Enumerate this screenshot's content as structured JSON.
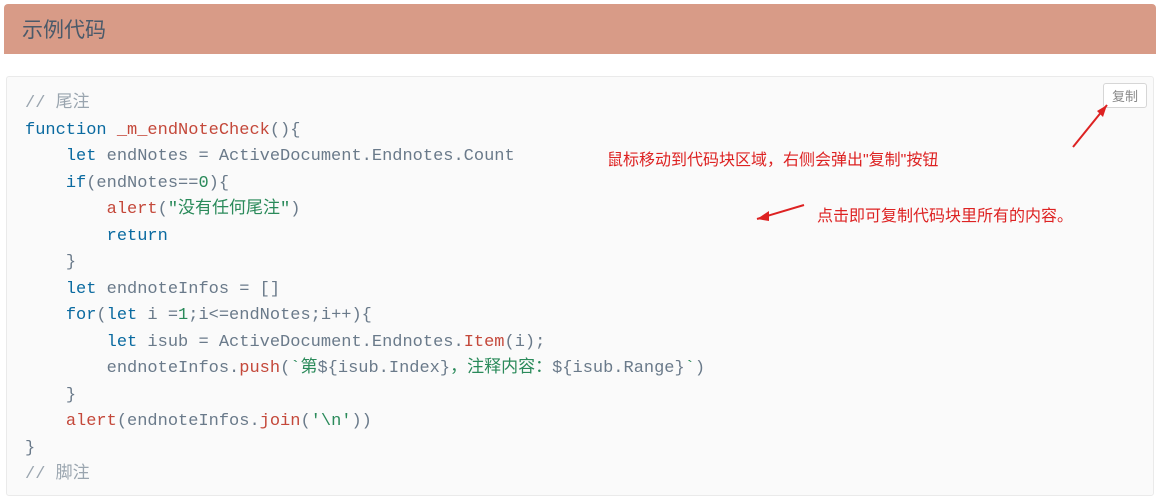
{
  "header": {
    "title": "示例代码"
  },
  "copy_button": {
    "label": "复制"
  },
  "annotations": {
    "line1": "鼠标移动到代码块区域，右侧会弹出\"复制\"按钮",
    "line2": "点击即可复制代码块里所有的内容。"
  },
  "code": {
    "raw": "// 尾注\nfunction _m_endNoteCheck(){\n    let endNotes = ActiveDocument.Endnotes.Count\n    if(endNotes==0){\n        alert(\"没有任何尾注\")\n        return\n    }\n    let endnoteInfos = []\n    for(let i =1;i<=endNotes;i++){\n        let isub = ActiveDocument.Endnotes.Item(i);\n        endnoteInfos.push(`第${isub.Index}，注释内容：${isub.Range}`)\n    }\n    alert(endnoteInfos.join('\\n'))\n}\n// 脚注",
    "l1_comment": "// 尾注",
    "l2_kw": "function",
    "l2_fn": "_m_endNoteCheck",
    "l2_rest": "(){",
    "l3_kw": "let",
    "l3_a": " endNotes = ActiveDocument.Endnotes.Count",
    "l4_kw": "if",
    "l4_a": "(endNotes==",
    "l4_num": "0",
    "l4_b": "){",
    "l5_fn": "alert",
    "l5_a": "(",
    "l5_str": "\"没有任何尾注\"",
    "l5_b": ")",
    "l6_kw": "return",
    "l7": "}",
    "l8_kw": "let",
    "l8_a": " endnoteInfos = []",
    "l9_kw1": "for",
    "l9_a": "(",
    "l9_kw2": "let",
    "l9_b": " i =",
    "l9_n1": "1",
    "l9_c": ";i<=endNotes;i++){",
    "l10_kw": "let",
    "l10_a": " isub = ActiveDocument.Endnotes.",
    "l10_fn": "Item",
    "l10_b": "(i);",
    "l11_a": "endnoteInfos.",
    "l11_fn": "push",
    "l11_b": "(",
    "l11_t1": "`第",
    "l11_t2": "${isub.Index}",
    "l11_t3": "，注释内容：",
    "l11_t4": "${isub.Range}",
    "l11_t5": "`",
    "l11_c": ")",
    "l12": "}",
    "l13_fn": "alert",
    "l13_a": "(endnoteInfos.",
    "l13_fn2": "join",
    "l13_b": "(",
    "l13_str": "'\\n'",
    "l13_c": "))",
    "l14": "}",
    "l15_comment": "// 脚注"
  }
}
